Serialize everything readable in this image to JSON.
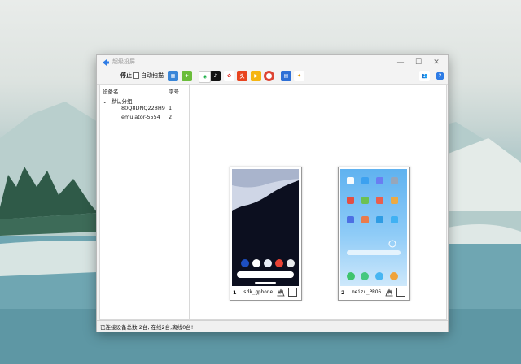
{
  "window": {
    "title": "超级投屏"
  },
  "toolbar": {
    "stop_label": "停止",
    "auto_scan_label": "自动扫描",
    "auto_scan_checked": false,
    "icons": [
      "devices-icon",
      "android-add-icon",
      "tiktok-icon",
      "wechat-icon",
      "kuaishou-icon",
      "toutiao-icon",
      "video-icon",
      "chrome-icon",
      "file-icon",
      "settings-icon"
    ]
  },
  "sidebar": {
    "col_name": "设备名",
    "col_index": "序号",
    "group_label": "默认分组",
    "devices": [
      {
        "name": "80Q8DNQ228H9",
        "index": "1"
      },
      {
        "name": "emulator-5554",
        "index": "2"
      }
    ]
  },
  "phones": [
    {
      "number": "1",
      "name": "sdk_gphone"
    },
    {
      "number": "2",
      "name": "meizu_PRO6"
    }
  ],
  "status": {
    "text": "已连接设备总数:2台, 在线2台,离线0台!"
  },
  "colors": {
    "accent": "#2d7be5",
    "titlebar": "#f3f3f3",
    "phone1_screen": "#0c0f1f",
    "phone2_screen": "#5fb2f0"
  }
}
